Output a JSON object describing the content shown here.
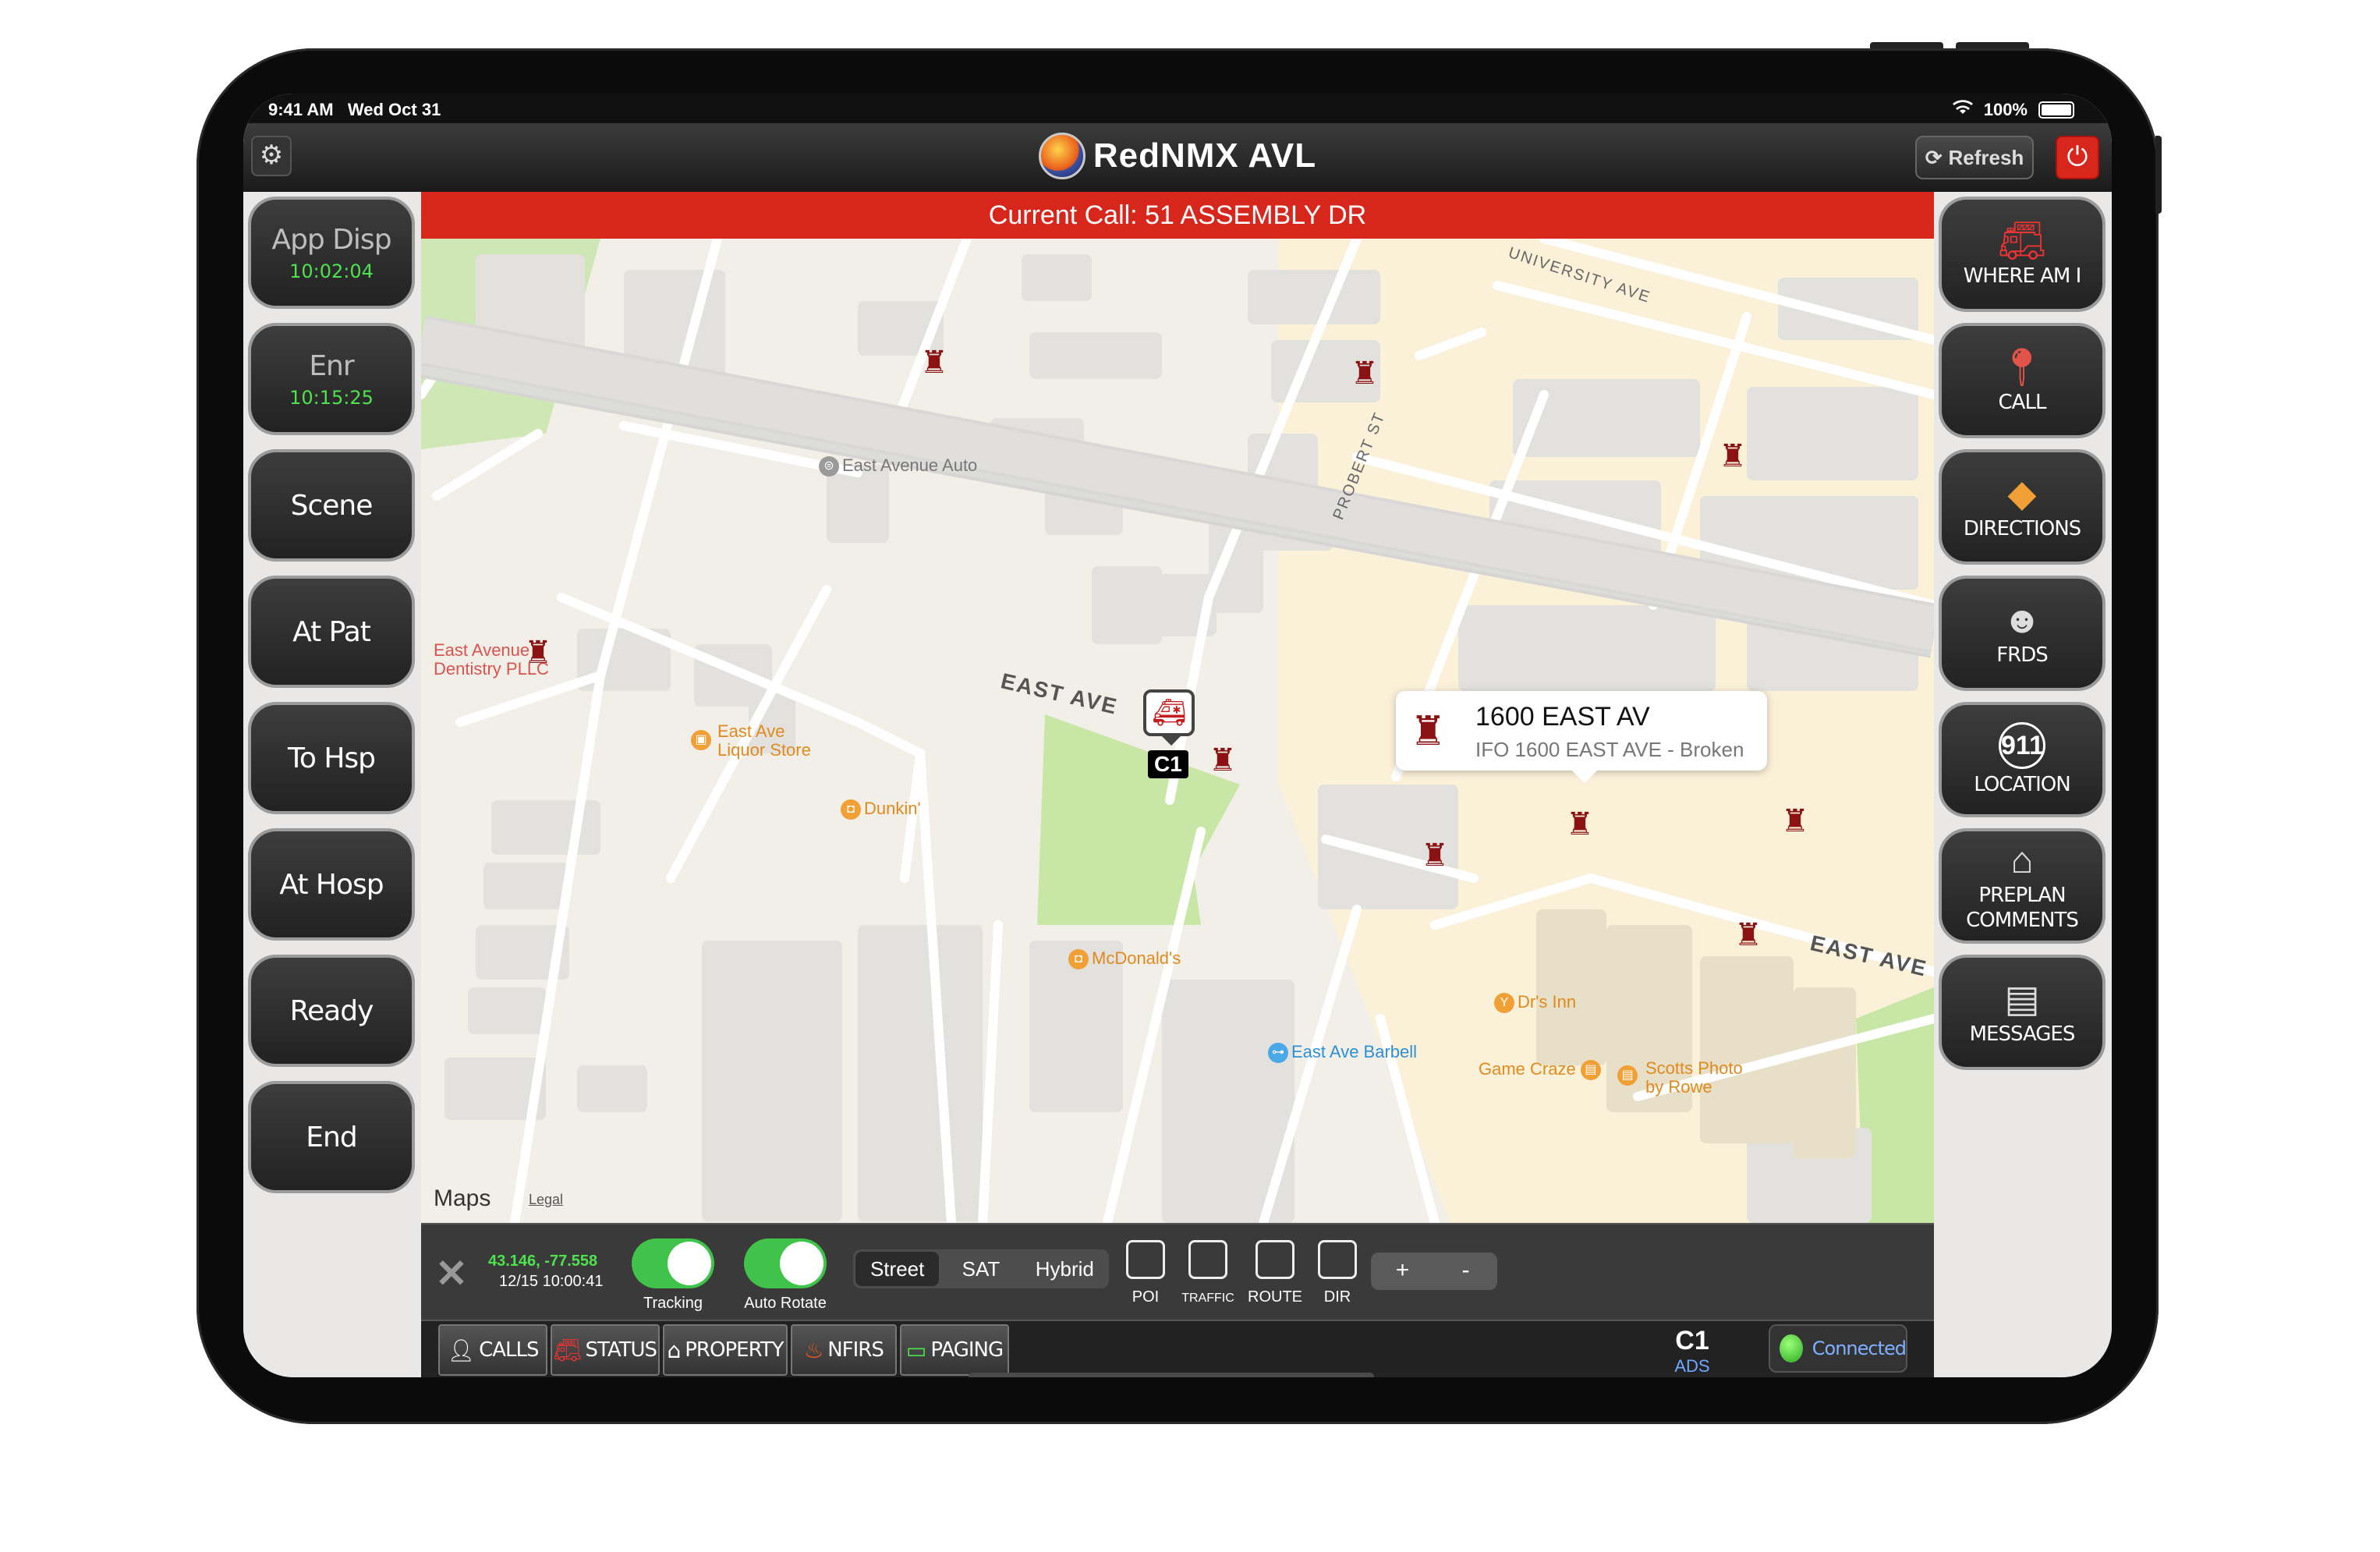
{
  "status_bar": {
    "time": "9:41 AM",
    "date": "Wed Oct 31",
    "wifi_icon": "wifi-icon",
    "battery": "100%"
  },
  "app": {
    "title": "RedNMX AVL",
    "refresh_label": "Refresh"
  },
  "call_bar": {
    "text": "Current Call: 51 ASSEMBLY DR"
  },
  "left_buttons": [
    {
      "label": "App Disp",
      "time": "10:02:04"
    },
    {
      "label": "Enr",
      "time": "10:15:25"
    },
    {
      "label": "Scene"
    },
    {
      "label": "At Pat"
    },
    {
      "label": "To Hsp"
    },
    {
      "label": "At Hosp"
    },
    {
      "label": "Ready"
    },
    {
      "label": "End"
    }
  ],
  "right_buttons": [
    {
      "label": "WHERE AM I",
      "icon": "map-pin-truck-icon"
    },
    {
      "label": "CALL",
      "icon": "location-pin-icon"
    },
    {
      "label": "DIRECTIONS",
      "icon": "directions-sign-icon"
    },
    {
      "label": "FRDS",
      "icon": "firefighter-icon"
    },
    {
      "label": "LOCATION",
      "icon": "911-icon"
    },
    {
      "label": "PREPLAN",
      "label2": "COMMENTS",
      "icon": "building-icon"
    },
    {
      "label": "MESSAGES",
      "icon": "chat-bubble-icon"
    }
  ],
  "map": {
    "streets": [
      "EAST AVE",
      "EAST AVE",
      "UNIVERSITY AVE",
      "PROBERT ST"
    ],
    "pois": [
      {
        "name": "East Avenue Auto"
      },
      {
        "name": "East Avenue",
        "name2": "Dentistry PLLC"
      },
      {
        "name": "East Ave",
        "name2": "Liquor Store"
      },
      {
        "name": "Dunkin'"
      },
      {
        "name": "McDonald's"
      },
      {
        "name": "Dr's Inn"
      },
      {
        "name": "East Ave Barbell"
      },
      {
        "name": "Game Craze"
      },
      {
        "name": "Scotts Photo",
        "name2": "by Rowe"
      }
    ],
    "callout": {
      "title": "1600 EAST AV",
      "subtitle": "IFO 1600 EAST AVE - Broken"
    },
    "unit_label": "C1",
    "attribution": "Maps",
    "legal": "Legal"
  },
  "controls": {
    "coords": "43.146, -77.558",
    "coord_time": "12/15 10:00:41",
    "tracking_label": "Tracking",
    "tracking_on": true,
    "auto_rotate_label": "Auto Rotate",
    "auto_rotate_on": true,
    "map_types": [
      "Street",
      "SAT",
      "Hybrid"
    ],
    "selected_map_type": "Street",
    "layers": [
      "POI",
      "TRAFFIC",
      "ROUTE",
      "DIR"
    ],
    "zoom_in": "+",
    "zoom_out": "-"
  },
  "tabs": [
    {
      "label": "CALLS",
      "icon": "person-icon"
    },
    {
      "label": "STATUS",
      "icon": "fire-truck-icon"
    },
    {
      "label": "PROPERTY",
      "icon": "house-search-icon"
    },
    {
      "label": "NFIRS",
      "icon": "flame-icon"
    },
    {
      "label": "PAGING",
      "icon": "pager-icon"
    }
  ],
  "unit": {
    "id": "C1",
    "sub": "ADS"
  },
  "connection": {
    "label": "Connected",
    "color": "#3fc34a"
  },
  "colors": {
    "accent_red": "#d7261c",
    "status_green": "#4ee34e",
    "toggle_green": "#3fc34a"
  }
}
